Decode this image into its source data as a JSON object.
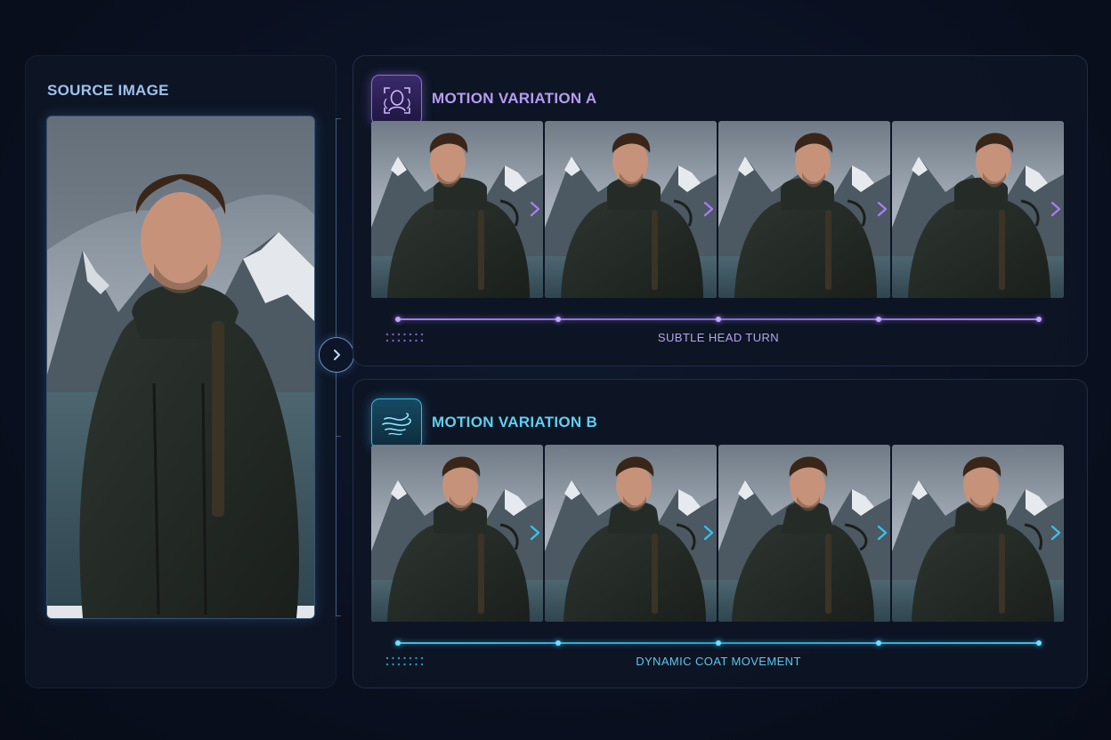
{
  "source": {
    "title": "SOURCE IMAGE"
  },
  "variations": [
    {
      "title": "MOTION VARIATION A",
      "icon": "face-tracking-icon",
      "caption": "SUBTLE HEAD TURN",
      "accent": "#a27ff0",
      "frame_count": 4,
      "timeline_keyframes": 5
    },
    {
      "title": "MOTION VARIATION B",
      "icon": "wind-flow-icon",
      "caption": "DYNAMIC COAT MOVEMENT",
      "accent": "#36c2ea",
      "frame_count": 4,
      "timeline_keyframes": 5
    }
  ],
  "colors": {
    "background": "#0a1020",
    "variation_a_accent": "#a27ff0",
    "variation_b_accent": "#36c2ea",
    "source_title": "#9ec2ec"
  }
}
